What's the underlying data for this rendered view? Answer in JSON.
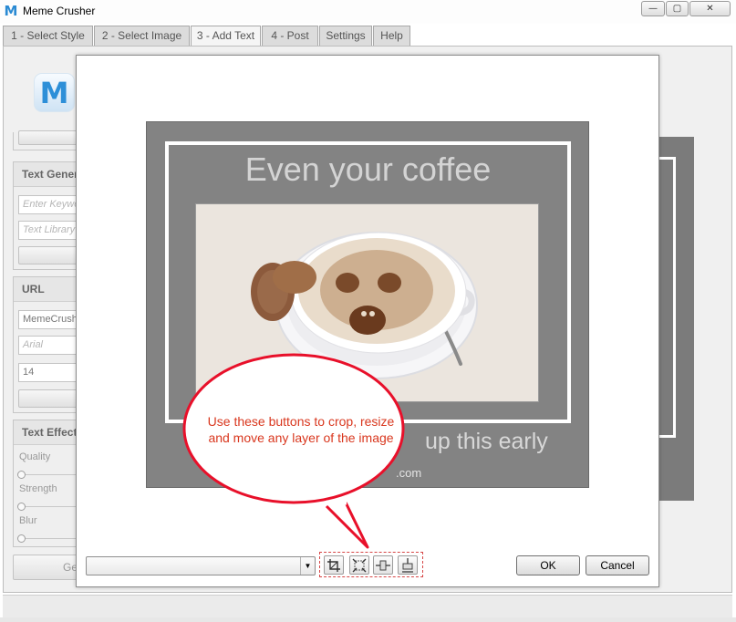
{
  "window": {
    "title": "Meme Crusher",
    "app_icon_glyph": "M",
    "controls": {
      "minimize": "—",
      "maximize": "▢",
      "close": "✕"
    }
  },
  "tabs": [
    {
      "label": "1 - Select Style"
    },
    {
      "label": "2 - Select Image"
    },
    {
      "label": "3 - Add Text"
    },
    {
      "label": "4 - Post"
    },
    {
      "label": "Settings"
    },
    {
      "label": "Help"
    }
  ],
  "active_tab": "3 - Add Text",
  "sidebar": {
    "logo_glyph": "M",
    "text_generator": {
      "header": "Text Generator",
      "keyword_placeholder": "Enter Keywords",
      "library_placeholder": "Text Library"
    },
    "url_panel": {
      "header": "URL",
      "url_value": "MemeCrusher.com",
      "font_placeholder": "Arial",
      "size_value": "14"
    },
    "text_effects": {
      "header": "Text Effects",
      "sliders": [
        {
          "label": "Quality",
          "value": 0
        },
        {
          "label": "Strength",
          "value": 0
        },
        {
          "label": "Blur",
          "value": 0
        }
      ]
    },
    "generate_button_label": "Generate"
  },
  "dialog": {
    "meme": {
      "top_text": "Even your coffee",
      "bottom_text": "up this early",
      "watermark": ".com",
      "background_color": "#838383",
      "frame_color": "#ffffff"
    },
    "layer_select_value": "",
    "tools": [
      {
        "name": "crop-icon",
        "tooltip": "Crop"
      },
      {
        "name": "resize-icon",
        "tooltip": "Resize"
      },
      {
        "name": "move-horizontal-icon",
        "tooltip": "Move"
      },
      {
        "name": "move-vertical-icon",
        "tooltip": "Move"
      }
    ],
    "ok_label": "OK",
    "cancel_label": "Cancel"
  },
  "callout": {
    "text": "Use these buttons to crop, resize and move any layer of the image",
    "color": "#e8102a",
    "text_color": "#d9371e"
  }
}
